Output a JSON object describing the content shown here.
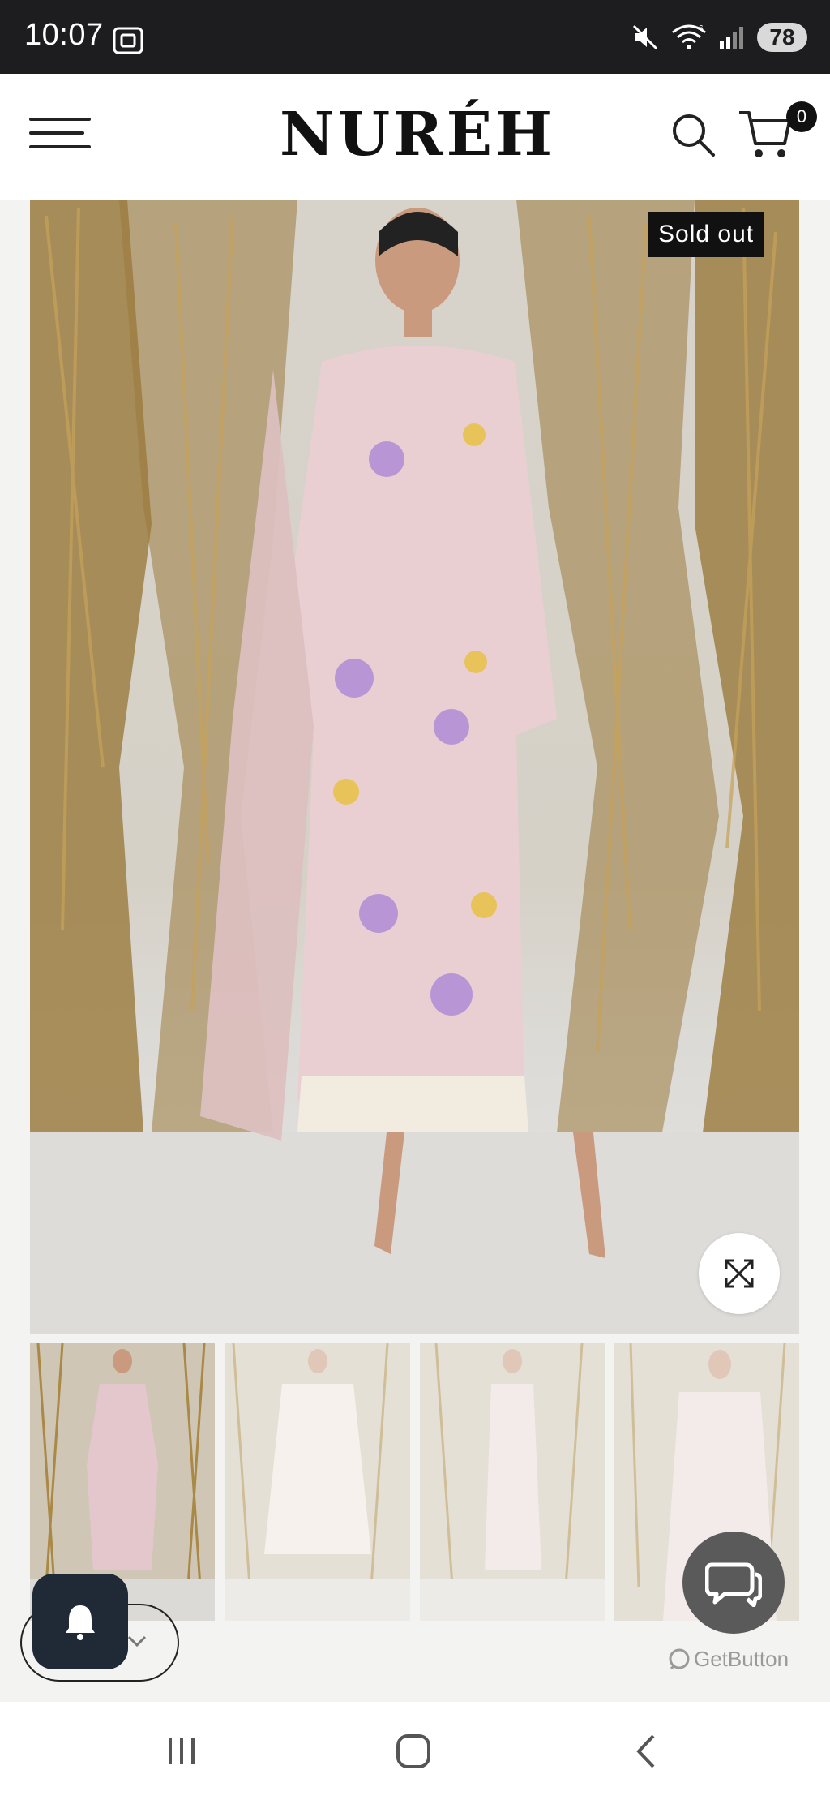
{
  "status_bar": {
    "time": "10:07",
    "battery": "78",
    "network_sup": "6"
  },
  "header": {
    "logo": "NURÉH",
    "cart_count": "0"
  },
  "product": {
    "badge": "Sold out",
    "thumbnail_count": 4
  },
  "widgets": {
    "getbutton_label": "GetButton"
  },
  "colors": {
    "status_bar_bg": "#1d1d1f",
    "badge_bg": "#111111",
    "bell_bg": "#1f2a36",
    "chat_bg": "#5a5a5a"
  },
  "icons": [
    "screenshot-icon",
    "mute-icon",
    "wifi-icon",
    "signal-icon",
    "menu-icon",
    "search-icon",
    "cart-icon",
    "expand-icon",
    "bell-icon",
    "chevron-down-icon",
    "chat-icon",
    "recent-apps-icon",
    "home-icon",
    "back-icon"
  ]
}
